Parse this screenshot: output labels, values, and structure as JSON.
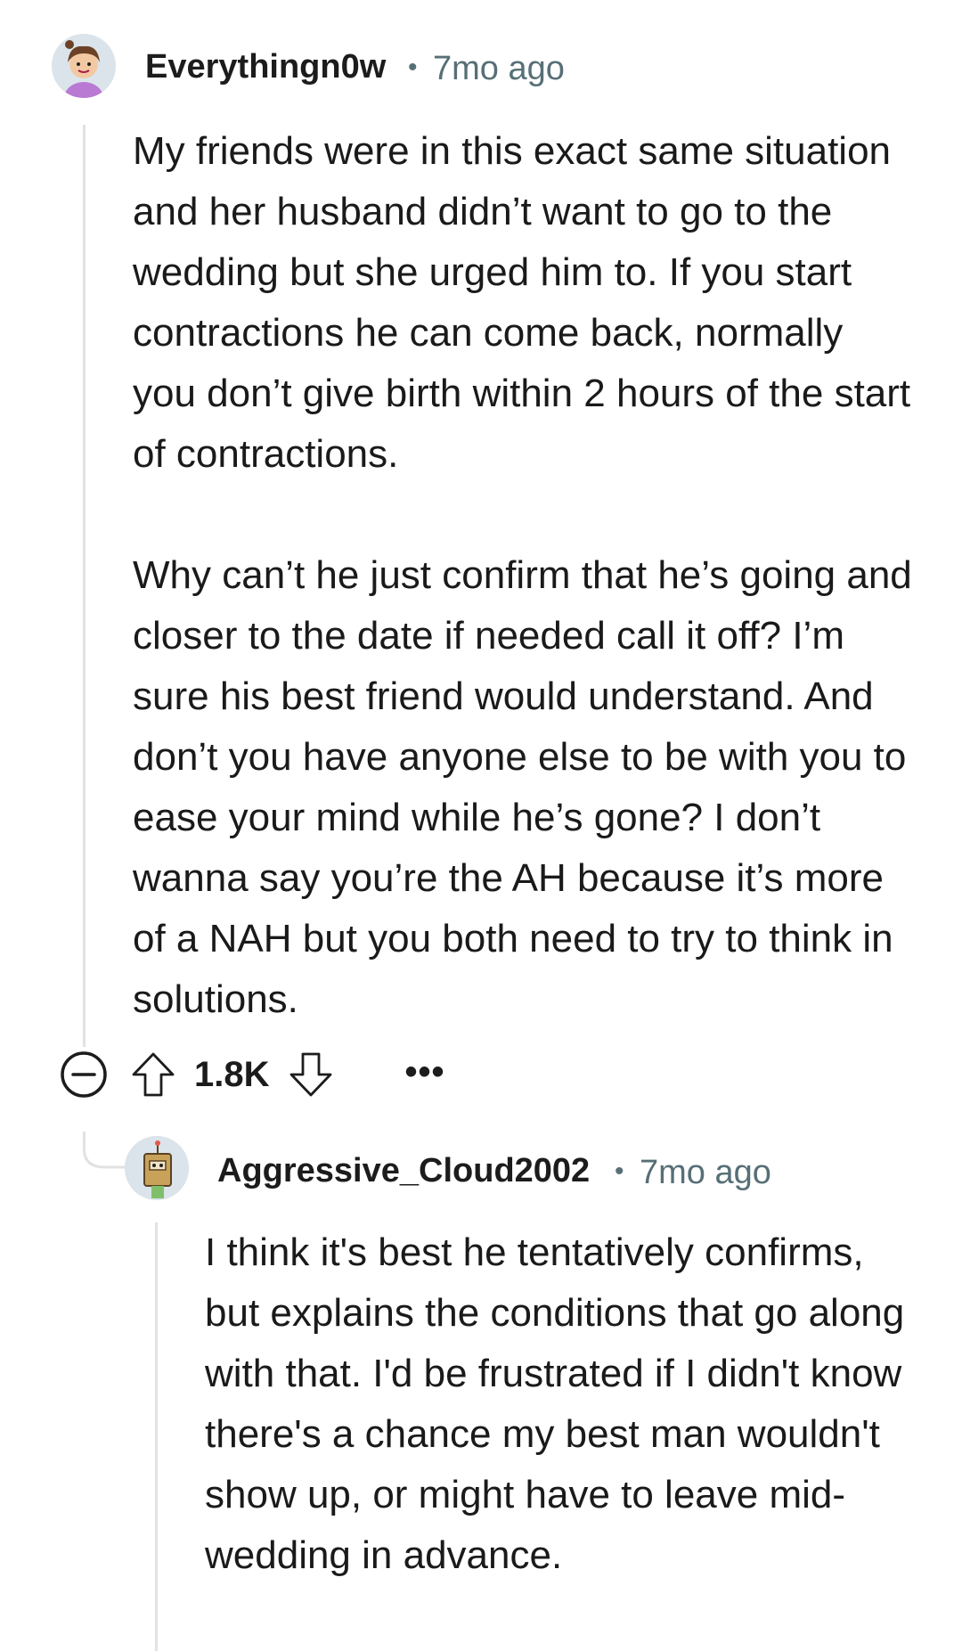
{
  "comments": [
    {
      "username": "Everythingn0w",
      "timestamp": "7mo ago",
      "separator": "•",
      "paragraphs": [
        "My friends were in this exact same situation and her husband didn’t want to go to the wedding but she urged him to. If you start contractions he can come back, normally you don’t give birth within 2 hours of the start of contractions.",
        "Why can’t he just confirm that he’s going and closer to the date if needed call it off? I’m sure his best friend would understand. And don’t you have anyone else to be with you to ease your mind while he’s gone? I don’t wanna say you’re the AH because it’s more of a NAH but you both need to try to think in solutions."
      ],
      "votes": "1.8K",
      "icons": {
        "collapse": "collapse-minus-icon",
        "upvote": "upvote-arrow-icon",
        "downvote": "downvote-arrow-icon",
        "more": "more-options-icon"
      },
      "more_label": "•••"
    },
    {
      "username": "Aggressive_Cloud2002",
      "timestamp": "7mo ago",
      "separator": "•",
      "paragraphs": [
        "I think it's best he tentatively confirms, but explains the conditions that go along with that. I'd be frustrated if I didn't know there's a chance my best man wouldn't show up, or might have to leave mid-wedding in advance."
      ]
    }
  ],
  "colors": {
    "text": "#1a1a1b",
    "meta": "#576f76",
    "thread_line": "#e0e2e4",
    "avatar1_shirt": "#b97ad4",
    "avatar2_body": "#c9a25a"
  }
}
